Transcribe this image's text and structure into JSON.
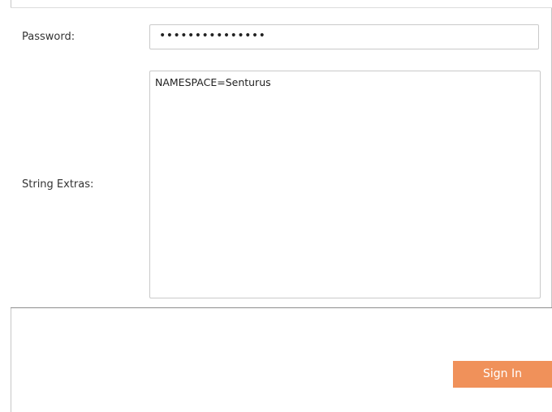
{
  "form": {
    "password": {
      "label": "Password:",
      "masked_value": "•••••••••••••••"
    },
    "string_extras": {
      "label": "String Extras:",
      "value": "NAMESPACE=Senturus"
    }
  },
  "actions": {
    "sign_in_label": "Sign In"
  },
  "colors": {
    "sign_in_button_bg": "#f0915a",
    "border": "#c9c9c9"
  }
}
